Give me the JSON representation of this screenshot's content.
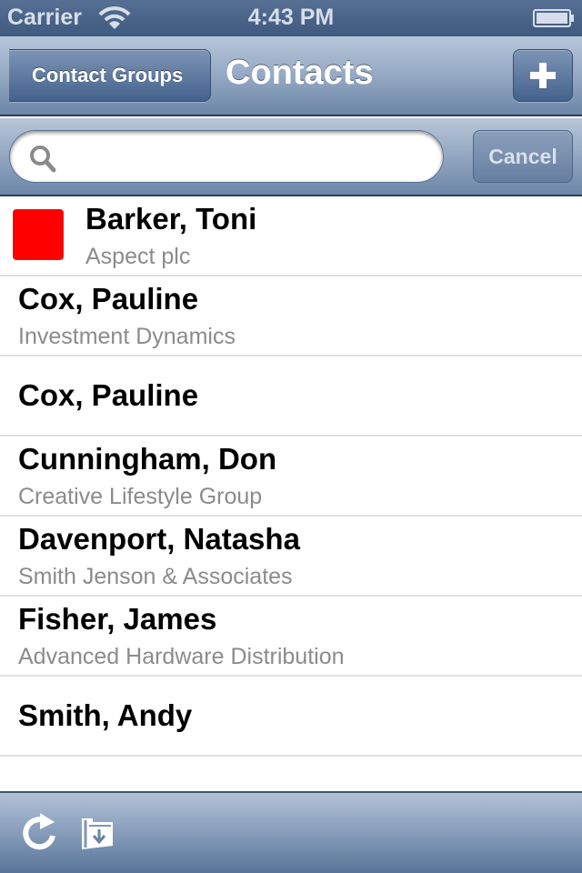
{
  "status_bar": {
    "carrier": "Carrier",
    "time": "4:43 PM",
    "icons": [
      "wifi-icon",
      "battery-icon"
    ]
  },
  "nav_bar": {
    "back_label": "Contact Groups",
    "title": "Contacts",
    "add_icon": "plus-icon"
  },
  "search": {
    "value": "",
    "placeholder": "",
    "cancel_label": "Cancel",
    "icon": "search-icon"
  },
  "contacts": [
    {
      "name": "Barker, Toni",
      "company": "Aspect plc",
      "thumb_color": "#ff0000"
    },
    {
      "name": "Cox, Pauline",
      "company": "Investment Dynamics"
    },
    {
      "name": "Cox, Pauline",
      "company": ""
    },
    {
      "name": "Cunningham, Don",
      "company": "Creative Lifestyle Group"
    },
    {
      "name": "Davenport, Natasha",
      "company": "Smith Jenson & Associates"
    },
    {
      "name": "Fisher, James",
      "company": "Advanced Hardware Distribution"
    },
    {
      "name": "Smith, Andy",
      "company": ""
    }
  ],
  "toolbar": {
    "items": [
      "refresh-icon",
      "folder-download-icon"
    ]
  },
  "colors": {
    "bar_blue": "#566f93",
    "thumb_red": "#ff0000",
    "secondary_text": "#8b8b8b"
  }
}
